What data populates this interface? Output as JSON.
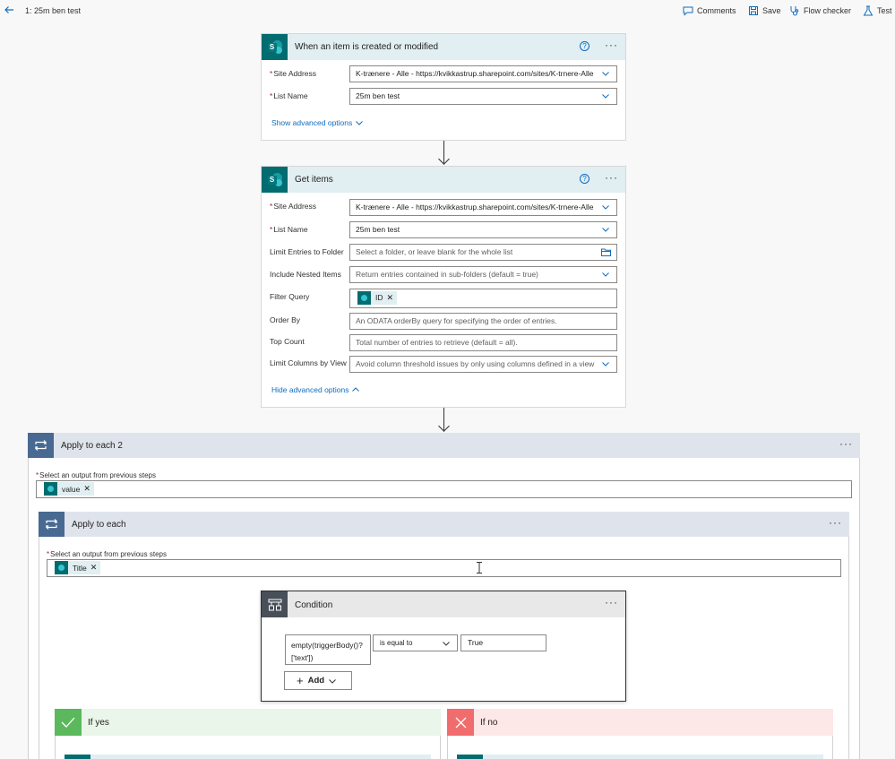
{
  "topbar": {
    "flow_title": "1: 25m ben test",
    "comments": "Comments",
    "save": "Save",
    "flow_checker": "Flow checker",
    "test": "Test"
  },
  "trigger": {
    "title": "When an item is created or modified",
    "site_address_label": "Site Address",
    "site_address_value": "K-trænere - Alle - https://kvikkastrup.sharepoint.com/sites/K-trnere-Alle",
    "list_name_label": "List Name",
    "list_name_value": "25m ben test",
    "show_advanced": "Show advanced options"
  },
  "get_items": {
    "title": "Get items",
    "site_address_label": "Site Address",
    "site_address_value": "K-trænere - Alle - https://kvikkastrup.sharepoint.com/sites/K-trnere-Alle",
    "list_name_label": "List Name",
    "list_name_value": "25m ben test",
    "limit_folder_label": "Limit Entries to Folder",
    "limit_folder_placeholder": "Select a folder, or leave blank for the whole list",
    "nested_label": "Include Nested Items",
    "nested_placeholder": "Return entries contained in sub-folders (default = true)",
    "filter_label": "Filter Query",
    "filter_token": "ID",
    "orderby_label": "Order By",
    "orderby_placeholder": "An ODATA orderBy query for specifying the order of entries.",
    "topcount_label": "Top Count",
    "topcount_placeholder": "Total number of entries to retrieve (default = all).",
    "limitcols_label": "Limit Columns by View",
    "limitcols_placeholder": "Avoid column threshold issues by only using columns defined in a view",
    "hide_advanced": "Hide advanced options"
  },
  "apply_each_2": {
    "title": "Apply to each 2",
    "select_label": "Select an output from previous steps",
    "token": "value"
  },
  "apply_each": {
    "title": "Apply to each",
    "select_label": "Select an output from previous steps",
    "token": "Title"
  },
  "condition": {
    "title": "Condition",
    "left_line1": "empty(triggerBody()?",
    "left_line2": "['text'])",
    "operator": "is equal to",
    "right_value": "True",
    "add_label": "Add"
  },
  "branches": {
    "yes": "If yes",
    "no": "If no"
  },
  "colors": {
    "accent": "#0f6cbd",
    "sharepoint": "#036c70",
    "loop": "#486991",
    "yes": "#5cb85c",
    "no": "#f16d6d"
  }
}
